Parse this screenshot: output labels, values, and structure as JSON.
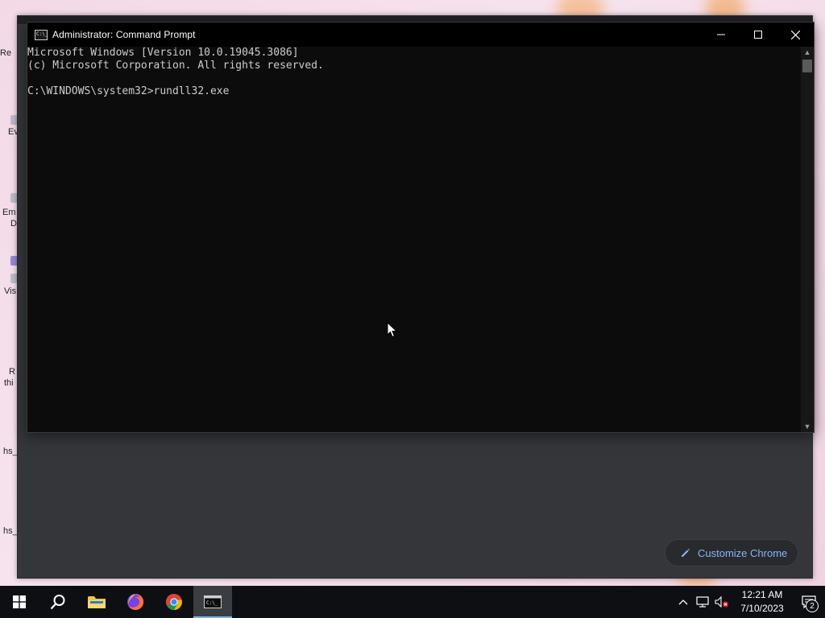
{
  "cmd": {
    "title": "Administrator: Command Prompt",
    "lines": [
      "Microsoft Windows [Version 10.0.19045.3086]",
      "(c) Microsoft Corporation. All rights reserved.",
      "",
      "C:\\WINDOWS\\system32>rundll32.exe"
    ]
  },
  "chrome": {
    "customize_label": "Customize Chrome"
  },
  "desktop_labels": [
    "Re",
    "Ev",
    "Em",
    "D",
    "Vis",
    "R",
    "thi",
    "hs_",
    "hs_"
  ],
  "taskbar": {
    "items": [
      "start-button",
      "search-button",
      "file-explorer",
      "firefox",
      "chrome",
      "command-prompt"
    ],
    "clock_time": "12:21 AM",
    "clock_date": "7/10/2023",
    "notification_count": "2"
  },
  "colors": {
    "accent": "#76b9ed",
    "chrome_link": "#8ab4f8",
    "cmd_text": "#cccccc"
  }
}
